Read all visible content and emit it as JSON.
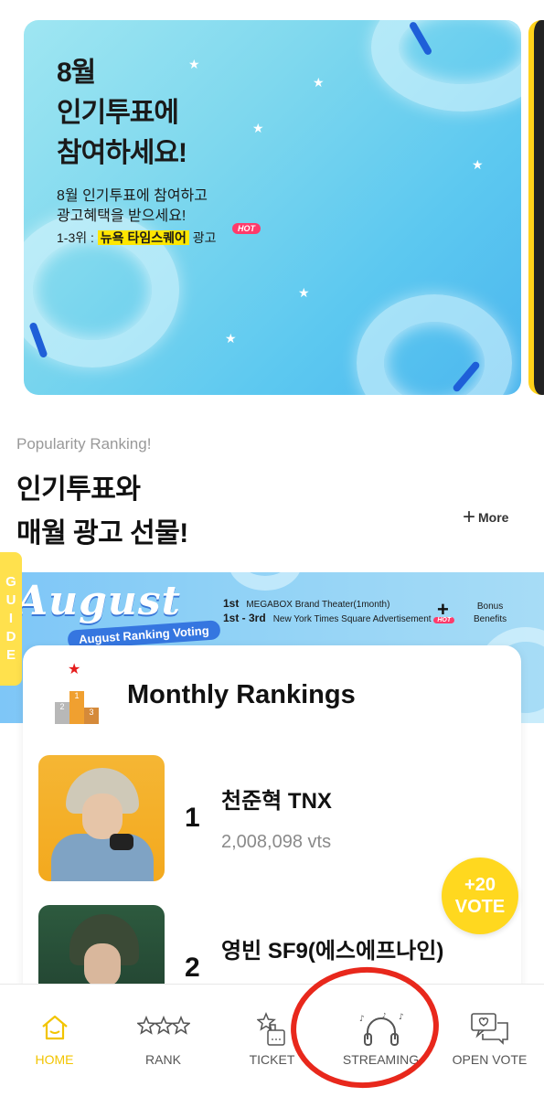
{
  "banner": {
    "title_line1": "8월",
    "title_line2": "인기투표에",
    "title_line3": "참여하세요!",
    "sub_line1": "8월 인기투표에 참여하고",
    "sub_line2": "광고혜택을 받으세요!",
    "rank_prefix": "1-3위 : ",
    "rank_highlight": "뉴욕 타임스퀘어",
    "rank_suffix": " 광고",
    "hot_badge": "HOT"
  },
  "section": {
    "label": "Popularity Ranking!",
    "title_line1": "인기투표와",
    "title_line2": "매월 광고 선물!",
    "more_label": "More"
  },
  "guide": {
    "letters": [
      "G",
      "U",
      "I",
      "D",
      "E"
    ]
  },
  "august": {
    "headline": "August",
    "pill": "August Ranking Voting",
    "line1_rank": "1st",
    "line1_text": "MEGABOX Brand Theater(1month)",
    "line2_rank": "1st - 3rd",
    "line2_text": "New York Times Square Advertisement",
    "hot": "HOT",
    "plus": "+",
    "bonus_line1": "Bonus",
    "bonus_line2": "Benefits"
  },
  "rankings": {
    "title": "Monthly Rankings",
    "podium": {
      "first": "1",
      "second": "2",
      "third": "3"
    },
    "items": [
      {
        "rank": "1",
        "name": "천준혁 TNX",
        "votes": "2,008,098 vts"
      },
      {
        "rank": "2",
        "name": "영빈 SF9(에스에프나인)",
        "votes": ""
      }
    ]
  },
  "vote_badge": {
    "line1": "+20",
    "line2": "VOTE"
  },
  "nav": {
    "items": [
      {
        "label": "HOME",
        "icon": "home-icon",
        "active": true
      },
      {
        "label": "RANK",
        "icon": "stars-icon",
        "active": false
      },
      {
        "label": "TICKET",
        "icon": "ticket-icon",
        "active": false
      },
      {
        "label": "STREAMING",
        "icon": "headphones-icon",
        "active": false
      },
      {
        "label": "OPEN VOTE",
        "icon": "chat-vote-icon",
        "active": false
      }
    ]
  },
  "colors": {
    "accent": "#f2c400",
    "annotation": "#e8281c",
    "badge": "#ffd81f"
  }
}
